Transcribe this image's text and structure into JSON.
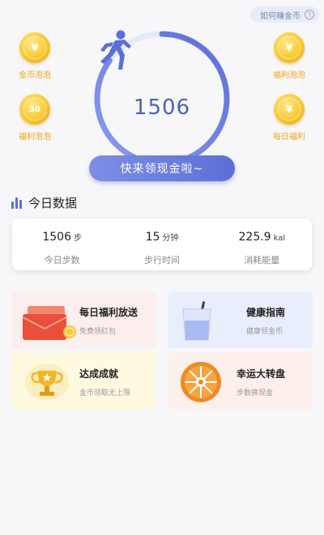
{
  "header": {
    "how_to_label": "如何赚金币",
    "help_glyph": "?"
  },
  "bubbles": [
    {
      "label": "金币泡泡",
      "coin_text": "¥"
    },
    {
      "label": "福利泡泡",
      "coin_text": "30"
    },
    {
      "label": "福利泡泡",
      "coin_text": "¥"
    },
    {
      "label": "每日福利",
      "coin_text": "¥"
    }
  ],
  "ring": {
    "steps": "1506",
    "progress": 0.85
  },
  "cta_label": "快来领现金啦~",
  "today": {
    "title": "今日数据",
    "stats": [
      {
        "value": "1506",
        "unit": "步",
        "name": "今日步数"
      },
      {
        "value": "15",
        "unit": "分钟",
        "name": "步行时间"
      },
      {
        "value": "225.9",
        "unit": "kal",
        "name": "消耗能量"
      }
    ]
  },
  "cards": [
    {
      "title": "每日福利放送",
      "sub": "免费领红包",
      "icon": "red-envelope-icon"
    },
    {
      "title": "健康指南",
      "sub": "健康领金币",
      "icon": "water-glass-icon"
    },
    {
      "title": "达成成就",
      "sub": "金币领取无上限",
      "icon": "trophy-icon"
    },
    {
      "title": "幸运大转盘",
      "sub": "步数换现金",
      "icon": "lucky-wheel-icon"
    }
  ],
  "colors": {
    "accent": "#5c6fd8",
    "coin": "#f9c830",
    "coin_label": "#f0a417"
  }
}
